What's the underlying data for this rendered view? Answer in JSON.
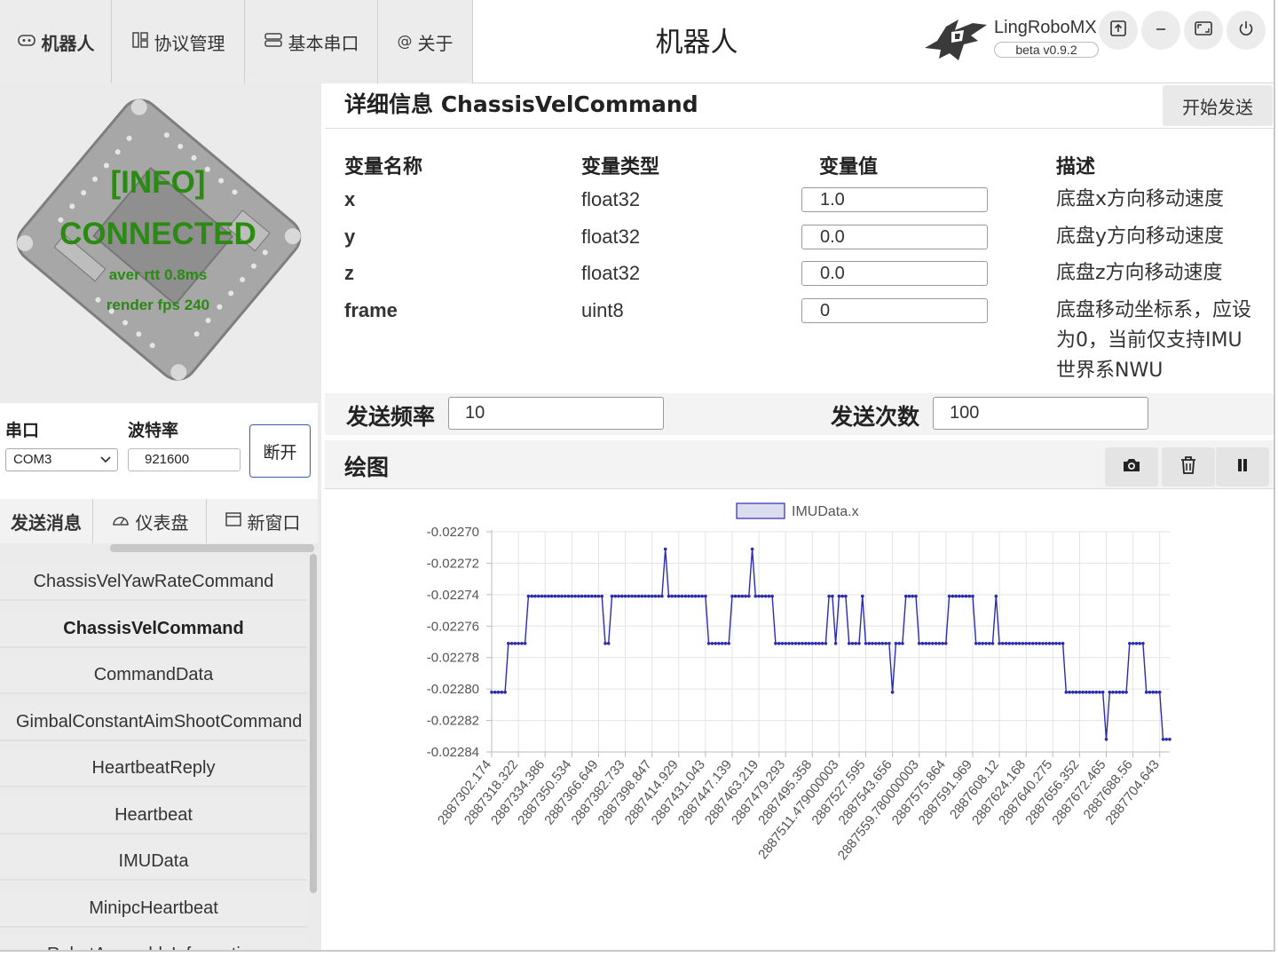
{
  "app": {
    "page_title": "机器人",
    "brand": "LingRoboMX",
    "version": "beta v0.9.2"
  },
  "nav": {
    "tabs": [
      {
        "label": "机器人",
        "icon": "robot-icon"
      },
      {
        "label": "协议管理",
        "icon": "protocol-icon"
      },
      {
        "label": "基本串口",
        "icon": "serial-port-icon"
      },
      {
        "label": "关于",
        "icon": "at-icon"
      }
    ]
  },
  "window_buttons": [
    "upload-icon",
    "minimize-icon",
    "maximize-icon",
    "power-icon"
  ],
  "status": {
    "line1": "[INFO]",
    "line2": "CONNECTED",
    "rtt": "aver rtt 0.8ms",
    "fps": "render fps 240",
    "color": "#2a8a12"
  },
  "serial": {
    "port_label": "串口",
    "baud_label": "波特率",
    "port_value": "COM3",
    "baud_value": "921600",
    "disconnect_label": "断开"
  },
  "left_tabs": [
    {
      "label": "发送消息",
      "icon": ""
    },
    {
      "label": "仪表盘",
      "icon": "dashboard-icon"
    },
    {
      "label": "新窗口",
      "icon": "window-icon"
    }
  ],
  "messages": [
    "ChassisVelYawRateCommand",
    "ChassisVelCommand",
    "CommandData",
    "GimbalConstantAimShootCommand",
    "HeartbeatReply",
    "Heartbeat",
    "IMUData",
    "MinipcHeartbeat",
    "RobotAssemblyInformation"
  ],
  "selected_message": "ChassisVelCommand",
  "detail": {
    "title": "详细信息 ChassisVelCommand",
    "start_label": "开始发送",
    "headers": [
      "变量名称",
      "变量类型",
      "变量值",
      "描述"
    ],
    "rows": [
      {
        "name": "x",
        "type": "float32",
        "value": "1.0",
        "desc": "底盘x方向移动速度"
      },
      {
        "name": "y",
        "type": "float32",
        "value": "0.0",
        "desc": "底盘y方向移动速度"
      },
      {
        "name": "z",
        "type": "float32",
        "value": "0.0",
        "desc": "底盘z方向移动速度"
      },
      {
        "name": "frame",
        "type": "uint8",
        "value": "0",
        "desc": "底盘移动坐标系，应设为0，当前仅支持IMU世界系NWU"
      }
    ],
    "freq_label": "发送频率",
    "freq_value": "10",
    "count_label": "发送次数",
    "count_value": "100"
  },
  "plot": {
    "title": "绘图",
    "buttons": [
      "camera-icon",
      "trash-icon",
      "pause-icon"
    ]
  },
  "chart_data": {
    "type": "line",
    "series": [
      {
        "name": "IMUData.x",
        "color": "#2b2bb0",
        "values": [
          -0.022802,
          -0.022802,
          -0.022802,
          -0.022802,
          -0.022802,
          -0.022771,
          -0.022771,
          -0.022771,
          -0.022771,
          -0.022771,
          -0.022771,
          -0.022741,
          -0.022741,
          -0.022741,
          -0.022741,
          -0.022741,
          -0.022741,
          -0.022741,
          -0.022741,
          -0.022741,
          -0.022741,
          -0.022741,
          -0.022741,
          -0.022741,
          -0.022741,
          -0.022741,
          -0.022741,
          -0.022741,
          -0.022741,
          -0.022741,
          -0.022741,
          -0.022741,
          -0.022741,
          -0.022741,
          -0.022771,
          -0.022771,
          -0.022741,
          -0.022741,
          -0.022741,
          -0.022741,
          -0.022741,
          -0.022741,
          -0.022741,
          -0.022741,
          -0.022741,
          -0.022741,
          -0.022741,
          -0.022741,
          -0.022741,
          -0.022741,
          -0.022741,
          -0.022741,
          -0.022711,
          -0.022741,
          -0.022741,
          -0.022741,
          -0.022741,
          -0.022741,
          -0.022741,
          -0.022741,
          -0.022741,
          -0.022741,
          -0.022741,
          -0.022741,
          -0.022741,
          -0.022771,
          -0.022771,
          -0.022771,
          -0.022771,
          -0.022771,
          -0.022771,
          -0.022771,
          -0.022741,
          -0.022741,
          -0.022741,
          -0.022741,
          -0.022741,
          -0.022741,
          -0.022711,
          -0.022741,
          -0.022741,
          -0.022741,
          -0.022741,
          -0.022741,
          -0.022741,
          -0.022771,
          -0.022771,
          -0.022771,
          -0.022771,
          -0.022771,
          -0.022771,
          -0.022771,
          -0.022771,
          -0.022771,
          -0.022771,
          -0.022771,
          -0.022771,
          -0.022771,
          -0.022771,
          -0.022771,
          -0.022771,
          -0.022741,
          -0.022741,
          -0.022771,
          -0.022741,
          -0.022741,
          -0.022741,
          -0.022771,
          -0.022771,
          -0.022771,
          -0.022771,
          -0.022741,
          -0.022771,
          -0.022771,
          -0.022771,
          -0.022771,
          -0.022771,
          -0.022771,
          -0.022771,
          -0.022771,
          -0.022802,
          -0.022771,
          -0.022771,
          -0.022771,
          -0.022741,
          -0.022741,
          -0.022741,
          -0.022741,
          -0.022771,
          -0.022771,
          -0.022771,
          -0.022771,
          -0.022771,
          -0.022771,
          -0.022771,
          -0.022771,
          -0.022771,
          -0.022741,
          -0.022741,
          -0.022741,
          -0.022741,
          -0.022741,
          -0.022741,
          -0.022741,
          -0.022741,
          -0.022771,
          -0.022771,
          -0.022771,
          -0.022771,
          -0.022771,
          -0.022771,
          -0.022741,
          -0.022771,
          -0.022771,
          -0.022771,
          -0.022771,
          -0.022771,
          -0.022771,
          -0.022771,
          -0.022771,
          -0.022771,
          -0.022771,
          -0.022771,
          -0.022771,
          -0.022771,
          -0.022771,
          -0.022771,
          -0.022771,
          -0.022771,
          -0.022771,
          -0.022771,
          -0.022771,
          -0.022802,
          -0.022802,
          -0.022802,
          -0.022802,
          -0.022802,
          -0.022802,
          -0.022802,
          -0.022802,
          -0.022802,
          -0.022802,
          -0.022802,
          -0.022802,
          -0.022832,
          -0.022802,
          -0.022802,
          -0.022802,
          -0.022802,
          -0.022802,
          -0.022802,
          -0.022771,
          -0.022771,
          -0.022771,
          -0.022771,
          -0.022771,
          -0.022802,
          -0.022802,
          -0.022802,
          -0.022802,
          -0.022802,
          -0.022832,
          -0.022832,
          -0.022832
        ]
      }
    ],
    "x_tick_labels": [
      "2887302.174",
      "2887318.322",
      "2887334.386",
      "2887350.534",
      "2887366.649",
      "2887382.733",
      "2887398.847",
      "2887414.929",
      "2887431.043",
      "2887447.139",
      "2887463.219",
      "2887479.293",
      "2887495.358",
      "2887511.479000003",
      "2887527.595",
      "2887543.656",
      "2887559.780000003",
      "2887575.864",
      "2887591.969",
      "2887608.12",
      "2887624.168",
      "2887640.275",
      "2887656.352",
      "2887672.465",
      "2887688.56",
      "2887704.643"
    ],
    "y_tick_labels": [
      "-0.02270",
      "-0.02272",
      "-0.02274",
      "-0.02276",
      "-0.02278",
      "-0.02280",
      "-0.02282",
      "-0.02284"
    ],
    "ylim": [
      -0.02285,
      -0.0227
    ],
    "grid": true,
    "legend": "top-center"
  }
}
